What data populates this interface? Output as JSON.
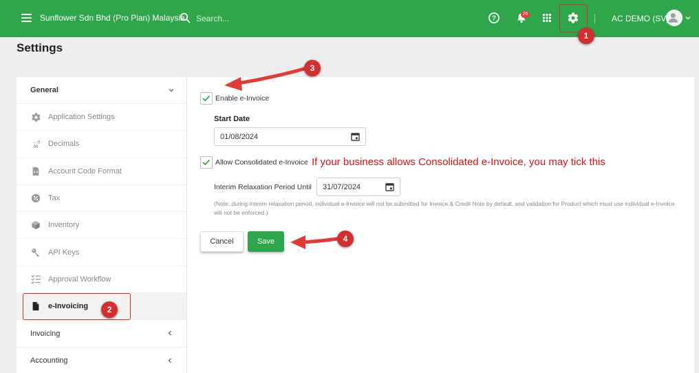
{
  "topbar": {
    "company": "Sunflower Sdn Bhd (Pro Plan) Malaysia",
    "search_placeholder": "Search...",
    "notification_count": "26",
    "user_name": "AC DEMO (SV)"
  },
  "page": {
    "title": "Settings"
  },
  "sidebar": {
    "group_general": "General",
    "items": [
      {
        "label": "Application Settings",
        "icon": "gear-icon"
      },
      {
        "label": "Decimals",
        "icon": "decimals-icon"
      },
      {
        "label": "Account Code Format",
        "icon": "code-icon"
      },
      {
        "label": "Tax",
        "icon": "percent-icon"
      },
      {
        "label": "Inventory",
        "icon": "box-icon"
      },
      {
        "label": "API Keys",
        "icon": "key-icon"
      },
      {
        "label": "Approval Workflow",
        "icon": "checklist-icon"
      },
      {
        "label": "e-Invoicing",
        "icon": "document-icon"
      }
    ],
    "sections": [
      {
        "label": "Invoicing"
      },
      {
        "label": "Accounting"
      }
    ]
  },
  "einvoice": {
    "enable_label": "Enable e-Invoice",
    "enable_checked": true,
    "start_date_label": "Start Date",
    "start_date_value": "01/08/2024",
    "consolidated_label": "Allow Consolidated e-Invoice",
    "consolidated_checked": true,
    "annotation": "If your business allows Consolidated e-Invoice, you may tick this",
    "relaxation_label": "Interim Relaxation Period Until",
    "relaxation_value": "31/07/2024",
    "note": "(Note: during interim relaxation period, individual e-Invoice will not be submitted for Invoice & Credit Note by default, and validation for Product which must use individual e-Invoice will not be enforced.)",
    "cancel_label": "Cancel",
    "save_label": "Save"
  },
  "callouts": {
    "one": "1",
    "two": "2",
    "three": "3",
    "four": "4"
  },
  "colors": {
    "brand": "#2fa64a",
    "callout": "#d32f2f",
    "annotation": "#e01010"
  }
}
